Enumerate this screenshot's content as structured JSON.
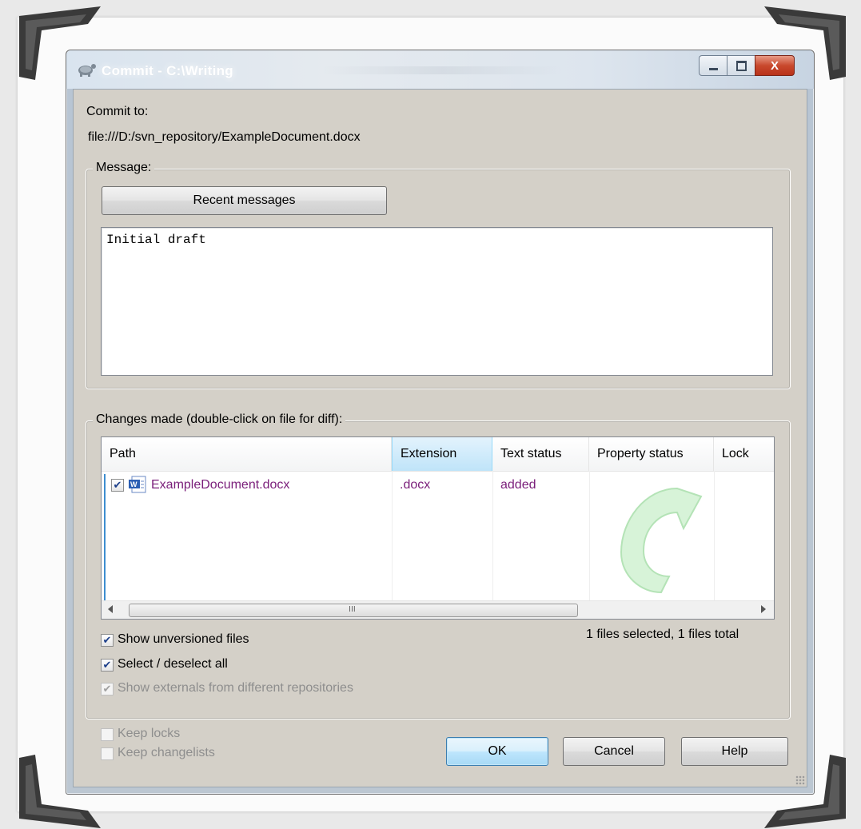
{
  "window": {
    "title": "Commit - C:\\Writing",
    "buttons": {
      "minimize": "–",
      "maximize": "□",
      "close": "X"
    }
  },
  "commit_to": {
    "label": "Commit to:",
    "url": "file:///D:/svn_repository/ExampleDocument.docx"
  },
  "message": {
    "group_label": "Message:",
    "recent_button": "Recent messages",
    "text": "Initial draft"
  },
  "changes": {
    "group_label": "Changes made (double-click on file for diff):",
    "columns": [
      "Path",
      "Extension",
      "Text status",
      "Property status",
      "Lock"
    ],
    "rows": [
      {
        "checked": true,
        "path": "ExampleDocument.docx",
        "extension": ".docx",
        "text_status": "added",
        "property_status": "",
        "lock": ""
      }
    ],
    "scroll_grip": "III",
    "summary": "1 files selected, 1 files total"
  },
  "options": {
    "show_unversioned": {
      "label": "Show unversioned files",
      "checked": true
    },
    "select_all": {
      "label": "Select / deselect all",
      "checked": true
    },
    "show_externals": {
      "label": "Show externals from different repositories",
      "checked": true,
      "disabled": true
    },
    "keep_locks": {
      "label": "Keep locks",
      "checked": false,
      "disabled": true
    },
    "keep_changelists": {
      "label": "Keep changelists",
      "checked": false,
      "disabled": true
    }
  },
  "footer_buttons": {
    "ok": "OK",
    "cancel": "Cancel",
    "help": "Help"
  },
  "colors": {
    "status_text": "#7a1e7a",
    "frame_corner": "#3a3a3a"
  },
  "icons": [
    "tortoise-icon",
    "word-document-icon",
    "checkmark-icon",
    "scroll-left-icon",
    "scroll-right-icon",
    "resize-grip-icon"
  ]
}
